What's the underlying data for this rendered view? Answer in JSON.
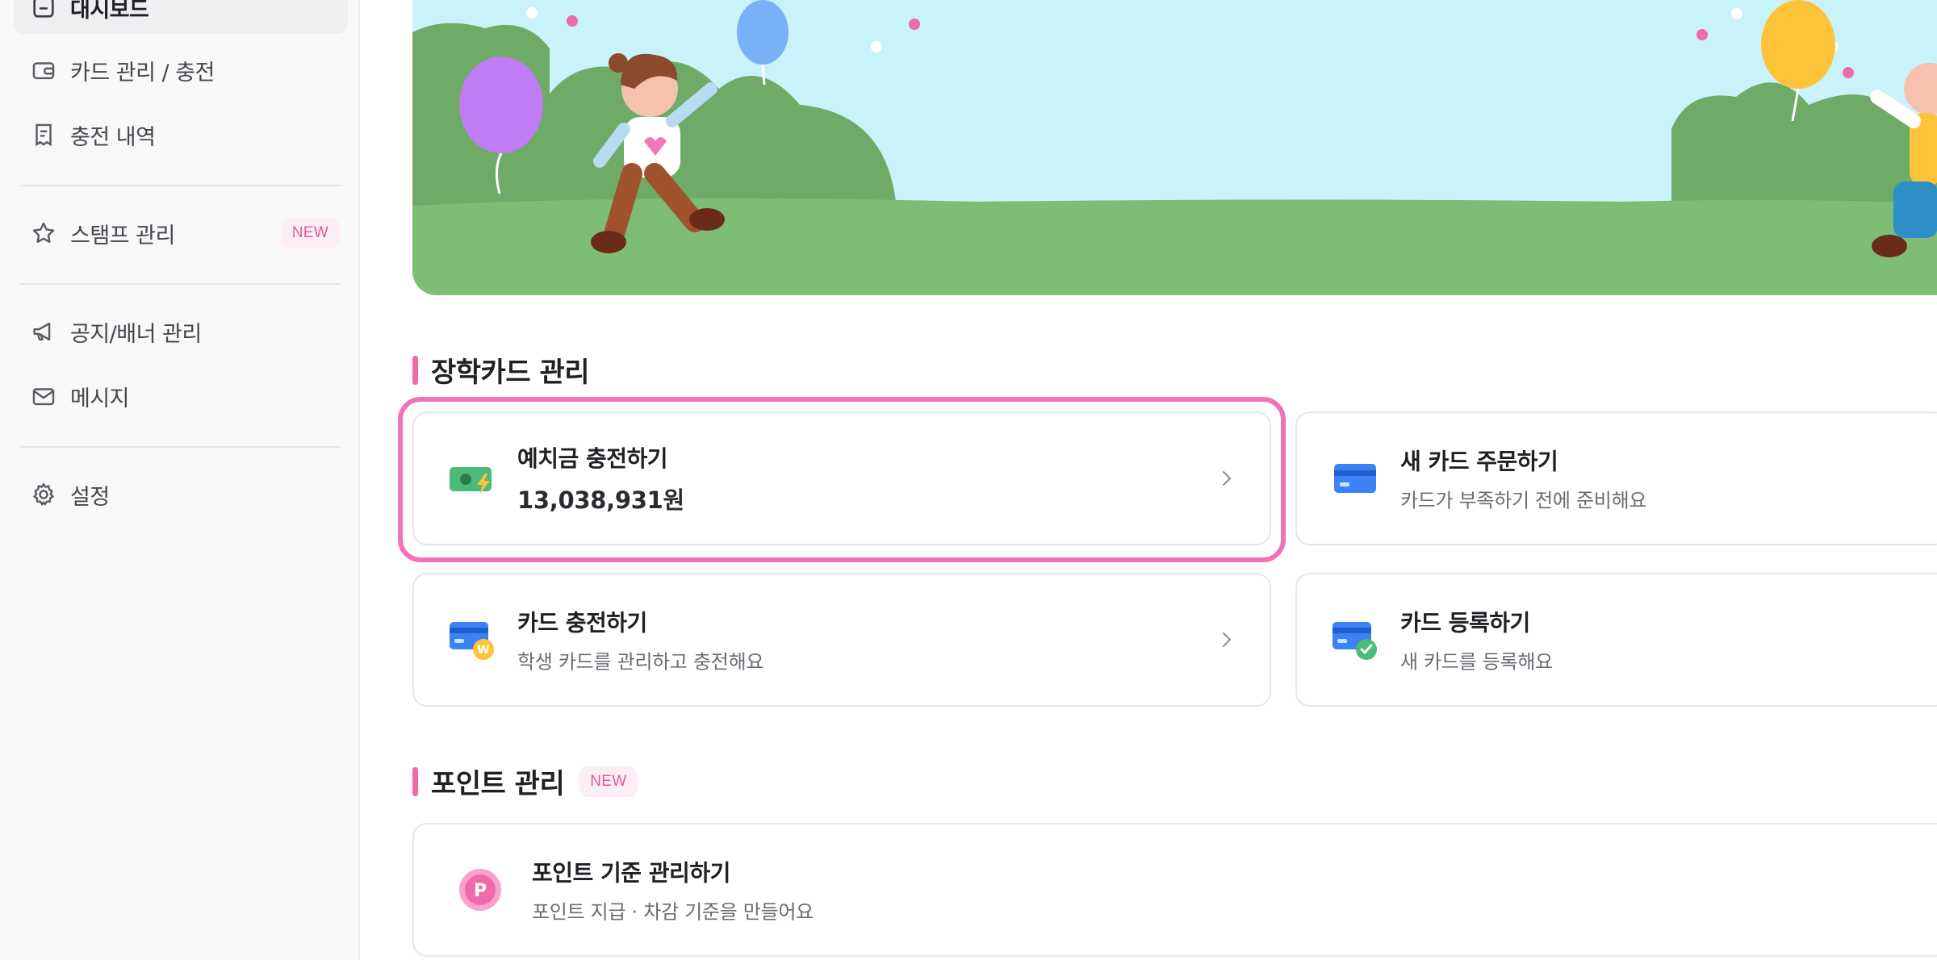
{
  "sidebar": {
    "items": [
      {
        "label": "대시보드",
        "icon": "dashboard-icon",
        "active": true
      },
      {
        "label": "카드 관리 / 충전",
        "icon": "wallet-icon"
      },
      {
        "label": "충전 내역",
        "icon": "receipt-icon"
      },
      {
        "label": "스탬프 관리",
        "icon": "star-icon",
        "badge": "NEW"
      },
      {
        "label": "공지/배너 관리",
        "icon": "megaphone-icon"
      },
      {
        "label": "메시지",
        "icon": "mail-icon"
      },
      {
        "label": "설정",
        "icon": "gear-icon"
      }
    ]
  },
  "sections": {
    "card_management": {
      "title": "장학카드 관리",
      "cards": [
        {
          "title": "예치금 충전하기",
          "amount": "13,038,931원",
          "icon": "cash-charge-icon"
        },
        {
          "title": "새 카드 주문하기",
          "subtitle": "카드가 부족하기 전에 준비해요",
          "icon": "credit-card-icon"
        },
        {
          "title": "카드 충전하기",
          "subtitle": "학생 카드를 관리하고 충전해요",
          "icon": "card-won-icon"
        },
        {
          "title": "카드 등록하기",
          "subtitle": "새 카드를 등록해요",
          "icon": "card-check-icon"
        }
      ]
    },
    "point_management": {
      "title": "포인트 관리",
      "badge": "NEW",
      "cards": [
        {
          "title": "포인트 기준 관리하기",
          "subtitle": "포인트 지급 · 차감 기준을 만들어요",
          "icon": "point-p-icon"
        }
      ]
    }
  },
  "colors": {
    "accent": "#ef6aa8",
    "highlight_border": "#f173b5",
    "badge_bg": "#fdeef5",
    "badge_text": "#e05a9c",
    "card_blue": "#3b82f6",
    "money_green": "#4cbb78"
  }
}
